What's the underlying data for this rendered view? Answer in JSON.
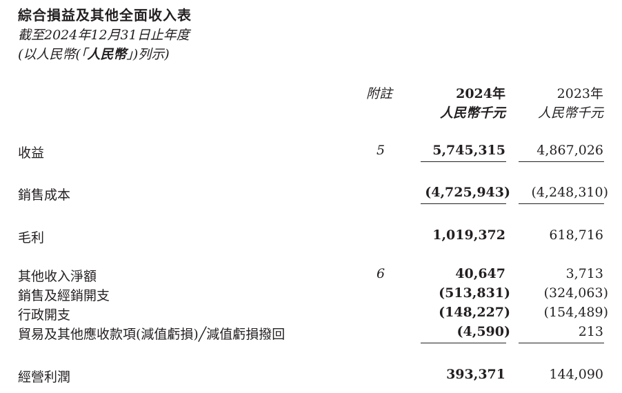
{
  "header": {
    "title": "綜合損益及其他全面收入表",
    "period": "截至2024年12月31日止年度",
    "currency_prefix": "(以人民幣(「",
    "currency_bold": "人民幣",
    "currency_suffix": "」)列示)"
  },
  "columns": {
    "note_header": "附註",
    "year_2024": "2024年",
    "year_2023": "2023年",
    "unit_2024": "人民幣千元",
    "unit_2023": "人民幣千元"
  },
  "rows": [
    {
      "label": "收益",
      "note": "5",
      "v2024": "5,745,315",
      "v2023": "4,867,026"
    },
    {
      "label": "銷售成本",
      "note": "",
      "v2024": "(4,725,943)",
      "v2023": "(4,248,310)"
    },
    {
      "label": "毛利",
      "note": "",
      "v2024": "1,019,372",
      "v2023": "618,716"
    },
    {
      "label": "其他收入淨額",
      "note": "6",
      "v2024": "40,647",
      "v2023": "3,713"
    },
    {
      "label": "銷售及經銷開支",
      "note": "",
      "v2024": "(513,831)",
      "v2023": "(324,063)"
    },
    {
      "label": "行政開支",
      "note": "",
      "v2024": "(148,227)",
      "v2023": "(154,489)"
    },
    {
      "label": "貿易及其他應收款項(減值虧損)╱減值虧損撥回",
      "note": "",
      "v2024": "(4,590)",
      "v2023": "213"
    },
    {
      "label": "經營利潤",
      "note": "",
      "v2024": "393,371",
      "v2023": "144,090"
    }
  ]
}
